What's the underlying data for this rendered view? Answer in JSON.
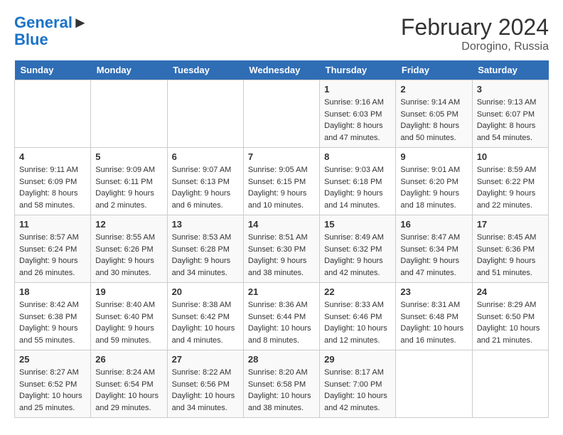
{
  "header": {
    "logo_line1": "General",
    "logo_line2": "Blue",
    "month_year": "February 2024",
    "location": "Dorogino, Russia"
  },
  "days_of_week": [
    "Sunday",
    "Monday",
    "Tuesday",
    "Wednesday",
    "Thursday",
    "Friday",
    "Saturday"
  ],
  "weeks": [
    [
      {
        "day": "",
        "info": ""
      },
      {
        "day": "",
        "info": ""
      },
      {
        "day": "",
        "info": ""
      },
      {
        "day": "",
        "info": ""
      },
      {
        "day": "1",
        "info": "Sunrise: 9:16 AM\nSunset: 6:03 PM\nDaylight: 8 hours\nand 47 minutes."
      },
      {
        "day": "2",
        "info": "Sunrise: 9:14 AM\nSunset: 6:05 PM\nDaylight: 8 hours\nand 50 minutes."
      },
      {
        "day": "3",
        "info": "Sunrise: 9:13 AM\nSunset: 6:07 PM\nDaylight: 8 hours\nand 54 minutes."
      }
    ],
    [
      {
        "day": "4",
        "info": "Sunrise: 9:11 AM\nSunset: 6:09 PM\nDaylight: 8 hours\nand 58 minutes."
      },
      {
        "day": "5",
        "info": "Sunrise: 9:09 AM\nSunset: 6:11 PM\nDaylight: 9 hours\nand 2 minutes."
      },
      {
        "day": "6",
        "info": "Sunrise: 9:07 AM\nSunset: 6:13 PM\nDaylight: 9 hours\nand 6 minutes."
      },
      {
        "day": "7",
        "info": "Sunrise: 9:05 AM\nSunset: 6:15 PM\nDaylight: 9 hours\nand 10 minutes."
      },
      {
        "day": "8",
        "info": "Sunrise: 9:03 AM\nSunset: 6:18 PM\nDaylight: 9 hours\nand 14 minutes."
      },
      {
        "day": "9",
        "info": "Sunrise: 9:01 AM\nSunset: 6:20 PM\nDaylight: 9 hours\nand 18 minutes."
      },
      {
        "day": "10",
        "info": "Sunrise: 8:59 AM\nSunset: 6:22 PM\nDaylight: 9 hours\nand 22 minutes."
      }
    ],
    [
      {
        "day": "11",
        "info": "Sunrise: 8:57 AM\nSunset: 6:24 PM\nDaylight: 9 hours\nand 26 minutes."
      },
      {
        "day": "12",
        "info": "Sunrise: 8:55 AM\nSunset: 6:26 PM\nDaylight: 9 hours\nand 30 minutes."
      },
      {
        "day": "13",
        "info": "Sunrise: 8:53 AM\nSunset: 6:28 PM\nDaylight: 9 hours\nand 34 minutes."
      },
      {
        "day": "14",
        "info": "Sunrise: 8:51 AM\nSunset: 6:30 PM\nDaylight: 9 hours\nand 38 minutes."
      },
      {
        "day": "15",
        "info": "Sunrise: 8:49 AM\nSunset: 6:32 PM\nDaylight: 9 hours\nand 42 minutes."
      },
      {
        "day": "16",
        "info": "Sunrise: 8:47 AM\nSunset: 6:34 PM\nDaylight: 9 hours\nand 47 minutes."
      },
      {
        "day": "17",
        "info": "Sunrise: 8:45 AM\nSunset: 6:36 PM\nDaylight: 9 hours\nand 51 minutes."
      }
    ],
    [
      {
        "day": "18",
        "info": "Sunrise: 8:42 AM\nSunset: 6:38 PM\nDaylight: 9 hours\nand 55 minutes."
      },
      {
        "day": "19",
        "info": "Sunrise: 8:40 AM\nSunset: 6:40 PM\nDaylight: 9 hours\nand 59 minutes."
      },
      {
        "day": "20",
        "info": "Sunrise: 8:38 AM\nSunset: 6:42 PM\nDaylight: 10 hours\nand 4 minutes."
      },
      {
        "day": "21",
        "info": "Sunrise: 8:36 AM\nSunset: 6:44 PM\nDaylight: 10 hours\nand 8 minutes."
      },
      {
        "day": "22",
        "info": "Sunrise: 8:33 AM\nSunset: 6:46 PM\nDaylight: 10 hours\nand 12 minutes."
      },
      {
        "day": "23",
        "info": "Sunrise: 8:31 AM\nSunset: 6:48 PM\nDaylight: 10 hours\nand 16 minutes."
      },
      {
        "day": "24",
        "info": "Sunrise: 8:29 AM\nSunset: 6:50 PM\nDaylight: 10 hours\nand 21 minutes."
      }
    ],
    [
      {
        "day": "25",
        "info": "Sunrise: 8:27 AM\nSunset: 6:52 PM\nDaylight: 10 hours\nand 25 minutes."
      },
      {
        "day": "26",
        "info": "Sunrise: 8:24 AM\nSunset: 6:54 PM\nDaylight: 10 hours\nand 29 minutes."
      },
      {
        "day": "27",
        "info": "Sunrise: 8:22 AM\nSunset: 6:56 PM\nDaylight: 10 hours\nand 34 minutes."
      },
      {
        "day": "28",
        "info": "Sunrise: 8:20 AM\nSunset: 6:58 PM\nDaylight: 10 hours\nand 38 minutes."
      },
      {
        "day": "29",
        "info": "Sunrise: 8:17 AM\nSunset: 7:00 PM\nDaylight: 10 hours\nand 42 minutes."
      },
      {
        "day": "",
        "info": ""
      },
      {
        "day": "",
        "info": ""
      }
    ]
  ]
}
